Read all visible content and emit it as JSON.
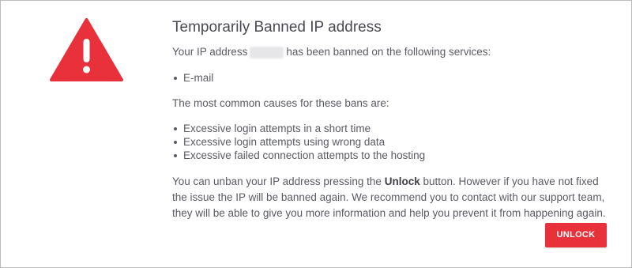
{
  "colors": {
    "accent": "#e8313b",
    "warning_red": "#e8313b",
    "text": "#5a5a64"
  },
  "icons": {
    "warning": "warning-triangle-icon"
  },
  "dialog": {
    "title": "Temporarily Banned IP address",
    "banned_prefix": "Your IP address",
    "banned_suffix": "has been banned on the following services:",
    "services": [
      "E-mail"
    ],
    "causes_intro": "The most common causes for these bans are:",
    "causes": [
      "Excessive login attempts in a short time",
      "Excessive login attempts using wrong data",
      "Excessive failed connection attempts to the hosting"
    ],
    "paragraph_part1": "You can unban your IP address pressing the ",
    "paragraph_bold": "Unlock",
    "paragraph_part2": " button. However if you have not fixed the issue the IP will be banned again. We recommend you to contact with our support team, they will be able to give you more information and help you prevent it from happening again.",
    "unlock_label": "UNLOCK"
  }
}
